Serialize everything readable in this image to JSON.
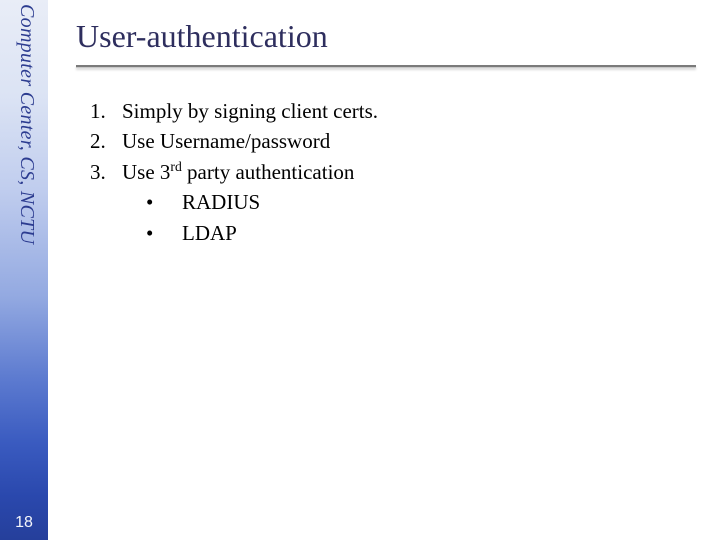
{
  "sidebar": {
    "org_text": "Computer Center, CS, NCTU",
    "page_number": "18"
  },
  "slide": {
    "title": "User-authentication",
    "items": [
      {
        "n": "1.",
        "text": "Simply by signing client certs."
      },
      {
        "n": "2.",
        "text": "Use Username/password"
      },
      {
        "n": "3.",
        "text_before": "Use 3",
        "sup": "rd",
        "text_after": " party authentication"
      }
    ],
    "subitems": [
      {
        "bullet": "•",
        "text": "RADIUS"
      },
      {
        "bullet": "•",
        "text": "LDAP"
      }
    ]
  }
}
